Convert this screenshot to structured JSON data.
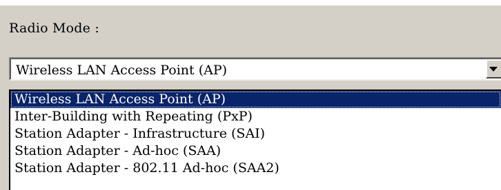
{
  "radio_mode": {
    "label": "Radio Mode :",
    "selected_value": "Wireless LAN Access Point (AP)",
    "options": [
      "Wireless LAN Access Point (AP)",
      "Inter-Building with Repeating (PxP)",
      "Station Adapter - Infrastructure (SAI)",
      "Station Adapter - Ad-hoc (SAA)",
      "Station Adapter - 802.11 Ad-hoc (SAA2)"
    ],
    "highlighted_index": 0
  },
  "colors": {
    "dialog_face": "#d4d0c8",
    "selection": "#0a246a",
    "selection_text": "#ffffff"
  },
  "icons": {
    "dropdown": "chevron-down-icon"
  }
}
